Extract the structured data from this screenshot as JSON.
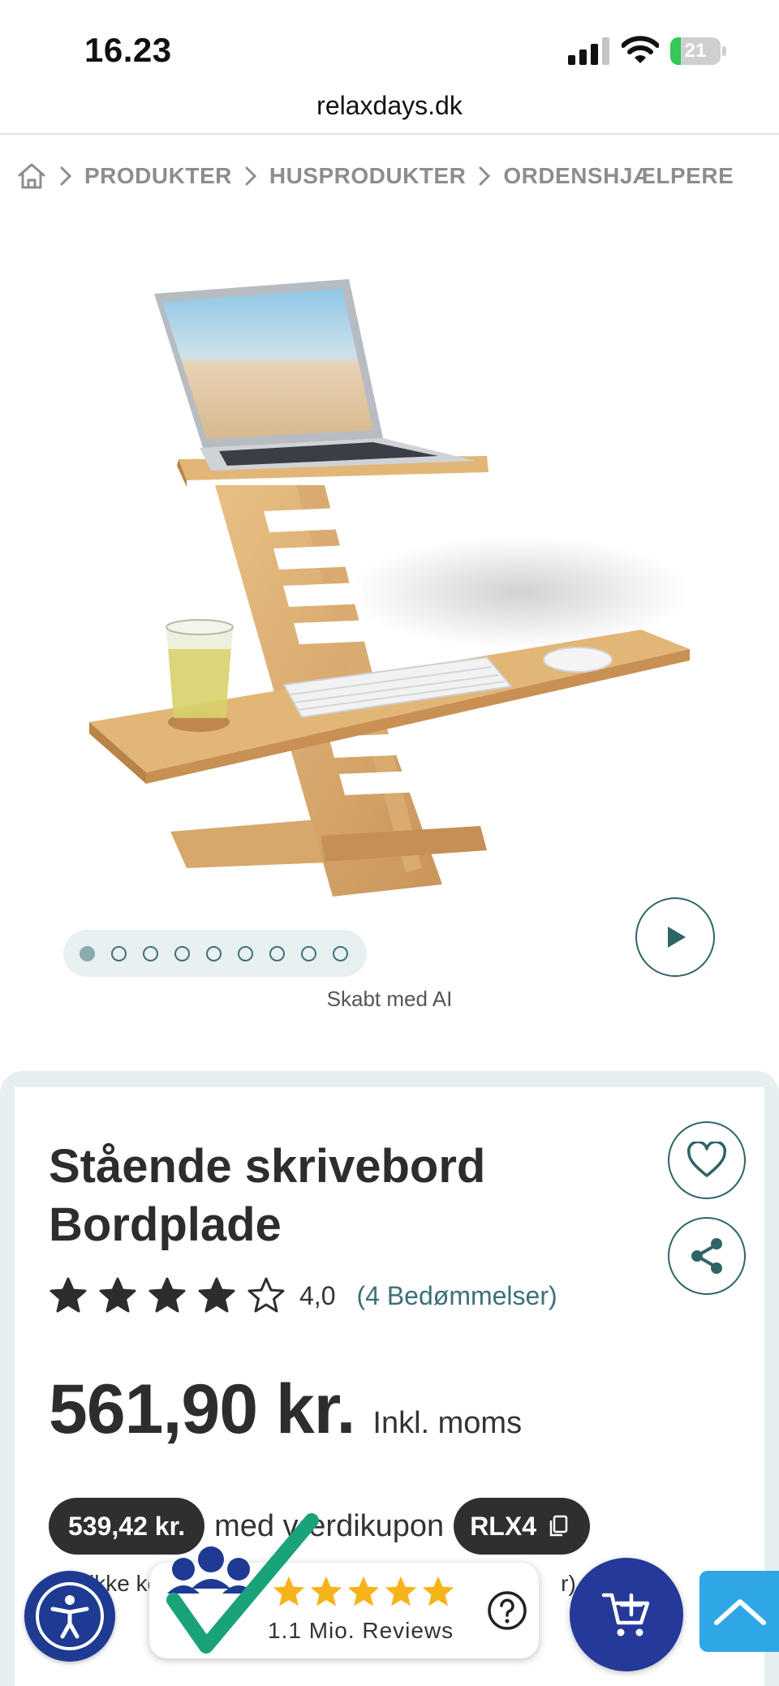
{
  "status_bar": {
    "time": "16.23",
    "battery_percent": 21,
    "battery_label": "21"
  },
  "browser": {
    "url": "relaxdays.dk"
  },
  "breadcrumb": {
    "home_icon": "home-icon",
    "items": [
      "PRODUKTER",
      "HUSPRODUKTER",
      "ORDENSHJÆLPERE"
    ]
  },
  "gallery": {
    "image_count": 9,
    "active_index": 0,
    "caption": "Skabt med AI"
  },
  "product": {
    "title": "Stående skrivebord Bordplade",
    "rating": 4.0,
    "rating_text": "4,0",
    "rating_link": "(4 Bedømmelser)",
    "stars_filled": 4,
    "stars_total": 5,
    "price": "561,90 kr.",
    "price_suffix": "Inkl. moms",
    "coupon_price": "539,42 kr.",
    "coupon_text": "med værdikupon",
    "coupon_code": "RLX4",
    "note_fragments": [
      "ikke ko",
      "r)"
    ]
  },
  "reviews_badge": {
    "stars": 5,
    "text": "1.1 Mio. Reviews"
  },
  "colors": {
    "accent_teal": "#2f6466",
    "link_teal": "#3a7177",
    "cart_blue": "#24399a",
    "scroll_top_blue": "#2fa6e6",
    "badge_star": "#f6b41a",
    "battery_green": "#34c759"
  }
}
